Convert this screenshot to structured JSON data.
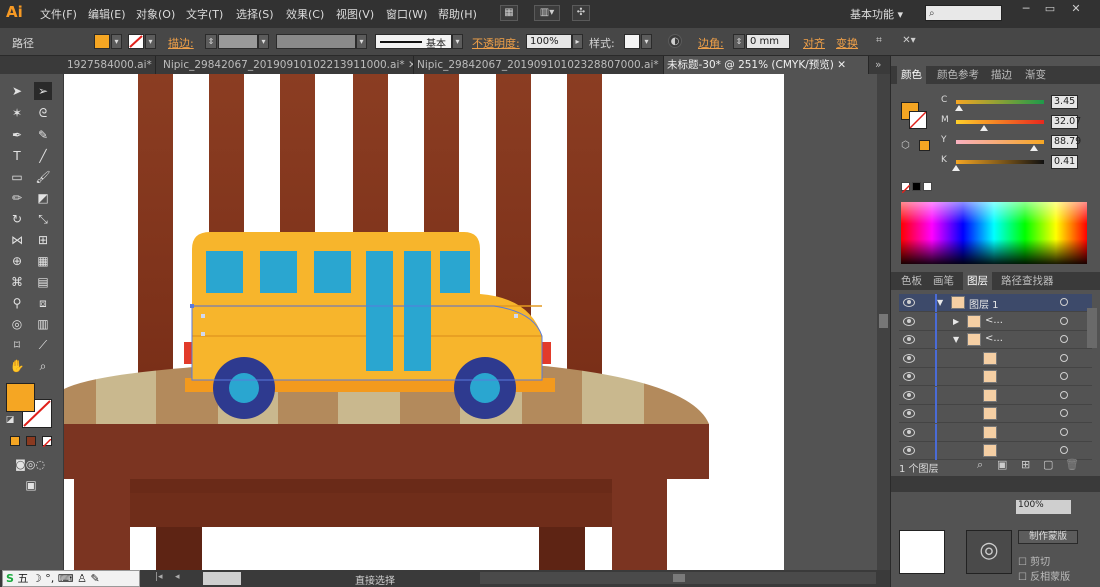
{
  "app": {
    "logo": "Ai",
    "menus": [
      "文件(F)",
      "编辑(E)",
      "对象(O)",
      "文字(T)",
      "选择(S)",
      "效果(C)",
      "视图(V)",
      "窗口(W)",
      "帮助(H)"
    ],
    "workspace": "基本功能",
    "accent": "#f79a24"
  },
  "controlbar": {
    "selection_type": "路径",
    "stroke_label": "描边:",
    "brush_label": "基本",
    "opacity_label": "不透明度:",
    "opacity_value": "100%",
    "style_label": "样式:",
    "corner_label": "边角:",
    "corner_value": "0 mm",
    "align_label": "对齐",
    "transform_label": "变换",
    "fill_color": "#f5a623"
  },
  "tabs": [
    {
      "label": "1927584000.ai*",
      "active": false
    },
    {
      "label": "Nipic_29842067_20190910102213911000.ai*",
      "active": false
    },
    {
      "label": "Nipic_29842067_20190910102328807000.ai*",
      "active": false
    },
    {
      "label": "未标题-30* @ 251% (CMYK/预览)",
      "active": true
    }
  ],
  "panels": {
    "color_tabs": [
      "颜色",
      "颜色参考",
      "描边",
      "渐变"
    ],
    "cmyk": [
      {
        "channel": "C",
        "value": "3.45",
        "fraction": 0.03
      },
      {
        "channel": "M",
        "value": "32.07",
        "fraction": 0.32
      },
      {
        "channel": "Y",
        "value": "88.79",
        "fraction": 0.89
      },
      {
        "channel": "K",
        "value": "0.41",
        "fraction": 0.0
      }
    ],
    "layer_tabs": [
      "色板",
      "画笔",
      "图层",
      "路径查找器"
    ],
    "layers": [
      {
        "label": "图层 1",
        "level": 0
      },
      {
        "label": "<...",
        "level": 1
      },
      {
        "label": "<...",
        "level": 1
      },
      {
        "label": "",
        "level": 2
      },
      {
        "label": "",
        "level": 2
      },
      {
        "label": "",
        "level": 2
      },
      {
        "label": "",
        "level": 2
      },
      {
        "label": "",
        "level": 2
      },
      {
        "label": "",
        "level": 2
      }
    ],
    "layer_count": "1 个图层",
    "bottom_labels": {
      "opacity_value": "100%",
      "make_mask": "制作蒙版",
      "clip": "剪切",
      "invert_mask": "反相蒙版"
    }
  },
  "status": {
    "zoom": "251%",
    "tool_name": "直接选择",
    "ime_label": "五"
  },
  "artwork": {
    "bus_color": "#f7b52c",
    "window_color": "#2aa6d0",
    "wheel_color": "#2e3a8f",
    "table_color": "#7a3320",
    "chair_color": "#8a3a20",
    "bench_light": "#c8b58c",
    "bench_dark": "#b38a5c"
  }
}
